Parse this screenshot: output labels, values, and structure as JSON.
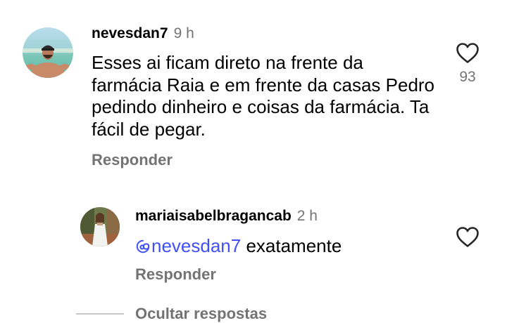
{
  "comment": {
    "username": "nevesdan7",
    "timestamp": "9 h",
    "text": "Esses ai ficam direto na frente da farmácia Raia e em frente da casas Pedro pedindo dinheiro e coisas da farmácia. Ta fácil de pegar.",
    "reply_label": "Responder",
    "like_count": "93",
    "like_icon": "heart-outline"
  },
  "reply": {
    "username": "mariaisabelbragancab",
    "timestamp": "2 h",
    "mention": "nevesdan7",
    "text": " exatamente",
    "reply_label": "Responder",
    "like_icon": "heart-outline"
  },
  "hide_replies_label": "Ocultar respostas",
  "colors": {
    "mention": "#4150f7",
    "secondary_text": "#737373",
    "primary_text": "#000000"
  }
}
